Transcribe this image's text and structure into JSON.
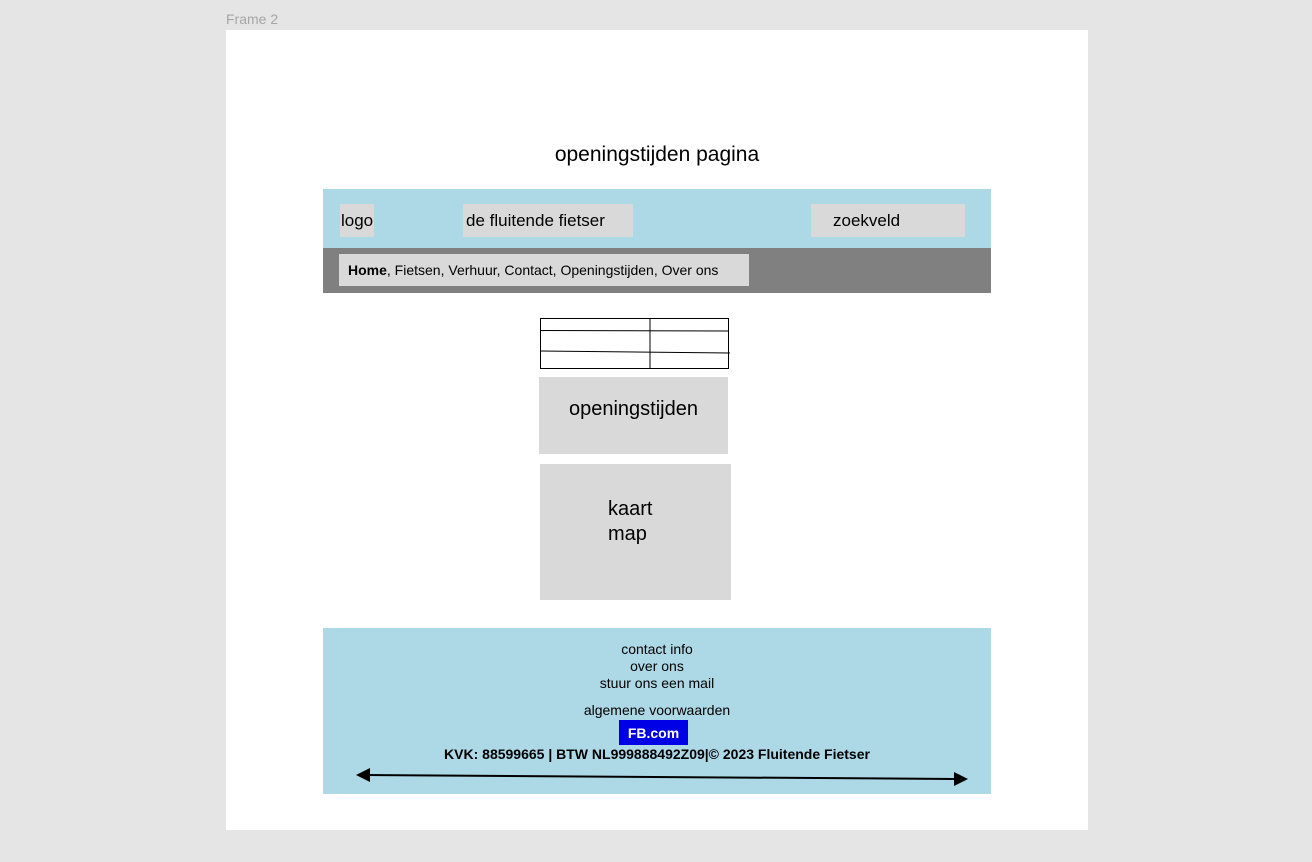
{
  "frame": {
    "label": "Frame 2"
  },
  "page": {
    "title": "openingstijden pagina"
  },
  "header": {
    "logo": "logo",
    "brand": "de fluitende fietser",
    "search": "zoekveld"
  },
  "nav": {
    "home": "Home",
    "rest": ", Fietsen, Verhuur, Contact, Openingstijden, Over ons"
  },
  "hours": {
    "label": "openingstijden"
  },
  "map": {
    "line1": "kaart",
    "line2": "map"
  },
  "footer": {
    "contact": "contact info",
    "about": "over ons",
    "mail": "stuur ons een mail",
    "terms": "algemene voorwaarden",
    "fb": "FB.com",
    "legal": "KVK: 88599665 | BTW NL999888492Z09|© 2023 Fluitende Fietser"
  },
  "colors": {
    "header_bg": "#add8e6",
    "nav_bg": "#808080",
    "box_bg": "#d9d9d9",
    "fb_bg": "#0000e6"
  }
}
